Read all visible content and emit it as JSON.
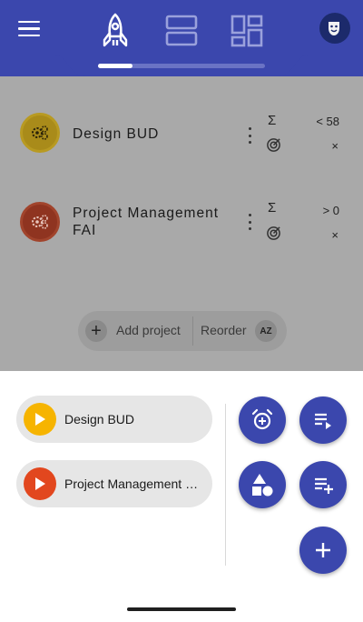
{
  "header": {
    "tabs": [
      {
        "icon": "rocket-icon",
        "active": true
      },
      {
        "icon": "rows-icon",
        "active": false
      },
      {
        "icon": "dashboard-icon",
        "active": false
      }
    ],
    "active_tab_index": 0,
    "avatar_icon": "theater-mask-icon",
    "accent_color": "#3b47ad"
  },
  "projects": [
    {
      "name": "Design BUD",
      "color": "#a98b1a",
      "sum_label": "Σ",
      "sum_value": "< 58",
      "target_value": "×"
    },
    {
      "name": "Project Management FAI",
      "color": "#8f3420",
      "sum_label": "Σ",
      "sum_value": "> 0",
      "target_value": "×"
    }
  ],
  "actions": {
    "add_plus": "+",
    "add_label": "Add project",
    "reorder_label": "Reorder",
    "sort_label": "AZ"
  },
  "sheet": {
    "chips": [
      {
        "label": "Design BUD",
        "color": "#f6b400"
      },
      {
        "label": "Project Management FAI",
        "color": "#e2471e"
      }
    ],
    "fabs": [
      "alarm-add-icon",
      "playlist-play-icon",
      "shapes-icon",
      "playlist-add-icon",
      "add-icon"
    ]
  }
}
